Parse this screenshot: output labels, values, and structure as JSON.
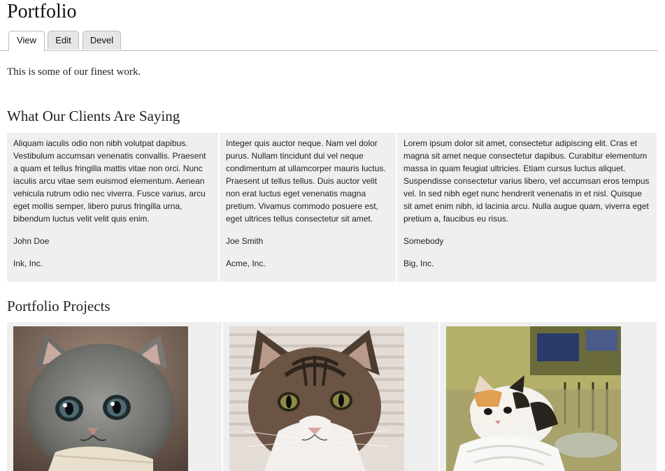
{
  "page": {
    "title": "Portfolio",
    "intro": "This is some of our finest work."
  },
  "tabs": [
    {
      "label": "View",
      "active": true
    },
    {
      "label": "Edit",
      "active": false
    },
    {
      "label": "Devel",
      "active": false
    }
  ],
  "clients_section": {
    "heading": "What Our Clients Are Saying",
    "testimonials": [
      {
        "quote": "Aliquam iaculis odio non nibh volutpat dapibus. Vestibulum accumsan venenatis convallis. Praesent a quam et tellus fringilla mattis vitae non orci. Nunc iaculis arcu vitae sem euismod elementum. Aenean vehicula rutrum odio nec viverra. Fusce varius, arcu eget mollis semper, libero purus fringilla urna, bibendum luctus velit velit quis enim.",
        "name": "John Doe",
        "company": "Ink, Inc."
      },
      {
        "quote": "Integer quis auctor neque. Nam vel dolor purus. Nullam tincidunt dui vel neque condimentum at ullamcorper mauris luctus. Praesent ut tellus tellus. Duis auctor velit non erat luctus eget venenatis magna pretium. Vivamus commodo posuere est, eget ultrices tellus consectetur sit amet.",
        "name": "Joe Smith",
        "company": "Acme, Inc."
      },
      {
        "quote": "Lorem ipsum dolor sit amet, consectetur adipiscing elit. Cras et magna sit amet neque consectetur dapibus. Curabitur elementum massa in quam feugiat ultricies. Etiam cursus luctus aliquet. Suspendisse consectetur varius libero, vel accumsan eros tempus vel. In sed nibh eget nunc hendrerit venenatis in et nisl. Quisque sit amet enim nibh, id lacinia arcu. Nulla augue quam, viverra eget pretium a, faucibus eu risus.",
        "name": "Somebody",
        "company": "Big, Inc."
      }
    ]
  },
  "projects_section": {
    "heading": "Portfolio Projects",
    "images": [
      "gray-kitten-photo",
      "tabby-cat-photo",
      "calico-kitten-photo"
    ]
  }
}
